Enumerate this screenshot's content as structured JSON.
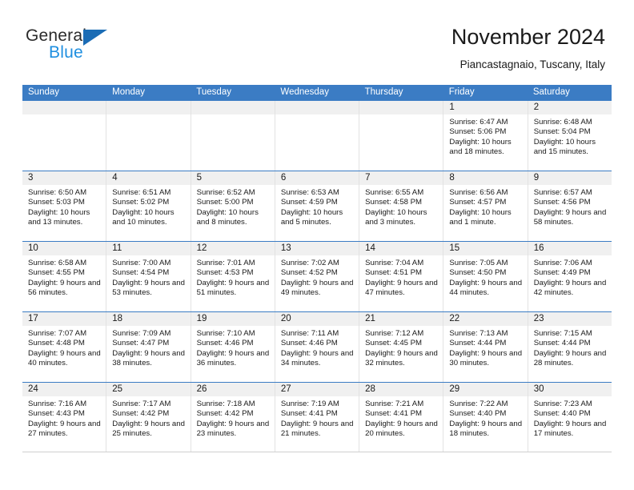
{
  "brand": {
    "name_part1": "General",
    "name_part2": "Blue",
    "triangle_icon": "triangle-icon",
    "color_dark": "#2b2b2b",
    "color_blue": "#1f8fe0",
    "color_triangle": "#1b6cb5"
  },
  "header": {
    "title": "November 2024",
    "subtitle": "Piancastagnaio, Tuscany, Italy"
  },
  "theme": {
    "header_row_bg": "#3b7cc4",
    "header_row_text": "#ffffff",
    "day_number_bg": "#f0f0f0",
    "cell_border": "#e2e2e2"
  },
  "weekdays": [
    "Sunday",
    "Monday",
    "Tuesday",
    "Wednesday",
    "Thursday",
    "Friday",
    "Saturday"
  ],
  "weeks": [
    [
      {
        "day": "",
        "sunrise": "",
        "sunset": "",
        "daylight": ""
      },
      {
        "day": "",
        "sunrise": "",
        "sunset": "",
        "daylight": ""
      },
      {
        "day": "",
        "sunrise": "",
        "sunset": "",
        "daylight": ""
      },
      {
        "day": "",
        "sunrise": "",
        "sunset": "",
        "daylight": ""
      },
      {
        "day": "",
        "sunrise": "",
        "sunset": "",
        "daylight": ""
      },
      {
        "day": "1",
        "sunrise": "Sunrise: 6:47 AM",
        "sunset": "Sunset: 5:06 PM",
        "daylight": "Daylight: 10 hours and 18 minutes."
      },
      {
        "day": "2",
        "sunrise": "Sunrise: 6:48 AM",
        "sunset": "Sunset: 5:04 PM",
        "daylight": "Daylight: 10 hours and 15 minutes."
      }
    ],
    [
      {
        "day": "3",
        "sunrise": "Sunrise: 6:50 AM",
        "sunset": "Sunset: 5:03 PM",
        "daylight": "Daylight: 10 hours and 13 minutes."
      },
      {
        "day": "4",
        "sunrise": "Sunrise: 6:51 AM",
        "sunset": "Sunset: 5:02 PM",
        "daylight": "Daylight: 10 hours and 10 minutes."
      },
      {
        "day": "5",
        "sunrise": "Sunrise: 6:52 AM",
        "sunset": "Sunset: 5:00 PM",
        "daylight": "Daylight: 10 hours and 8 minutes."
      },
      {
        "day": "6",
        "sunrise": "Sunrise: 6:53 AM",
        "sunset": "Sunset: 4:59 PM",
        "daylight": "Daylight: 10 hours and 5 minutes."
      },
      {
        "day": "7",
        "sunrise": "Sunrise: 6:55 AM",
        "sunset": "Sunset: 4:58 PM",
        "daylight": "Daylight: 10 hours and 3 minutes."
      },
      {
        "day": "8",
        "sunrise": "Sunrise: 6:56 AM",
        "sunset": "Sunset: 4:57 PM",
        "daylight": "Daylight: 10 hours and 1 minute."
      },
      {
        "day": "9",
        "sunrise": "Sunrise: 6:57 AM",
        "sunset": "Sunset: 4:56 PM",
        "daylight": "Daylight: 9 hours and 58 minutes."
      }
    ],
    [
      {
        "day": "10",
        "sunrise": "Sunrise: 6:58 AM",
        "sunset": "Sunset: 4:55 PM",
        "daylight": "Daylight: 9 hours and 56 minutes."
      },
      {
        "day": "11",
        "sunrise": "Sunrise: 7:00 AM",
        "sunset": "Sunset: 4:54 PM",
        "daylight": "Daylight: 9 hours and 53 minutes."
      },
      {
        "day": "12",
        "sunrise": "Sunrise: 7:01 AM",
        "sunset": "Sunset: 4:53 PM",
        "daylight": "Daylight: 9 hours and 51 minutes."
      },
      {
        "day": "13",
        "sunrise": "Sunrise: 7:02 AM",
        "sunset": "Sunset: 4:52 PM",
        "daylight": "Daylight: 9 hours and 49 minutes."
      },
      {
        "day": "14",
        "sunrise": "Sunrise: 7:04 AM",
        "sunset": "Sunset: 4:51 PM",
        "daylight": "Daylight: 9 hours and 47 minutes."
      },
      {
        "day": "15",
        "sunrise": "Sunrise: 7:05 AM",
        "sunset": "Sunset: 4:50 PM",
        "daylight": "Daylight: 9 hours and 44 minutes."
      },
      {
        "day": "16",
        "sunrise": "Sunrise: 7:06 AM",
        "sunset": "Sunset: 4:49 PM",
        "daylight": "Daylight: 9 hours and 42 minutes."
      }
    ],
    [
      {
        "day": "17",
        "sunrise": "Sunrise: 7:07 AM",
        "sunset": "Sunset: 4:48 PM",
        "daylight": "Daylight: 9 hours and 40 minutes."
      },
      {
        "day": "18",
        "sunrise": "Sunrise: 7:09 AM",
        "sunset": "Sunset: 4:47 PM",
        "daylight": "Daylight: 9 hours and 38 minutes."
      },
      {
        "day": "19",
        "sunrise": "Sunrise: 7:10 AM",
        "sunset": "Sunset: 4:46 PM",
        "daylight": "Daylight: 9 hours and 36 minutes."
      },
      {
        "day": "20",
        "sunrise": "Sunrise: 7:11 AM",
        "sunset": "Sunset: 4:46 PM",
        "daylight": "Daylight: 9 hours and 34 minutes."
      },
      {
        "day": "21",
        "sunrise": "Sunrise: 7:12 AM",
        "sunset": "Sunset: 4:45 PM",
        "daylight": "Daylight: 9 hours and 32 minutes."
      },
      {
        "day": "22",
        "sunrise": "Sunrise: 7:13 AM",
        "sunset": "Sunset: 4:44 PM",
        "daylight": "Daylight: 9 hours and 30 minutes."
      },
      {
        "day": "23",
        "sunrise": "Sunrise: 7:15 AM",
        "sunset": "Sunset: 4:44 PM",
        "daylight": "Daylight: 9 hours and 28 minutes."
      }
    ],
    [
      {
        "day": "24",
        "sunrise": "Sunrise: 7:16 AM",
        "sunset": "Sunset: 4:43 PM",
        "daylight": "Daylight: 9 hours and 27 minutes."
      },
      {
        "day": "25",
        "sunrise": "Sunrise: 7:17 AM",
        "sunset": "Sunset: 4:42 PM",
        "daylight": "Daylight: 9 hours and 25 minutes."
      },
      {
        "day": "26",
        "sunrise": "Sunrise: 7:18 AM",
        "sunset": "Sunset: 4:42 PM",
        "daylight": "Daylight: 9 hours and 23 minutes."
      },
      {
        "day": "27",
        "sunrise": "Sunrise: 7:19 AM",
        "sunset": "Sunset: 4:41 PM",
        "daylight": "Daylight: 9 hours and 21 minutes."
      },
      {
        "day": "28",
        "sunrise": "Sunrise: 7:21 AM",
        "sunset": "Sunset: 4:41 PM",
        "daylight": "Daylight: 9 hours and 20 minutes."
      },
      {
        "day": "29",
        "sunrise": "Sunrise: 7:22 AM",
        "sunset": "Sunset: 4:40 PM",
        "daylight": "Daylight: 9 hours and 18 minutes."
      },
      {
        "day": "30",
        "sunrise": "Sunrise: 7:23 AM",
        "sunset": "Sunset: 4:40 PM",
        "daylight": "Daylight: 9 hours and 17 minutes."
      }
    ]
  ]
}
